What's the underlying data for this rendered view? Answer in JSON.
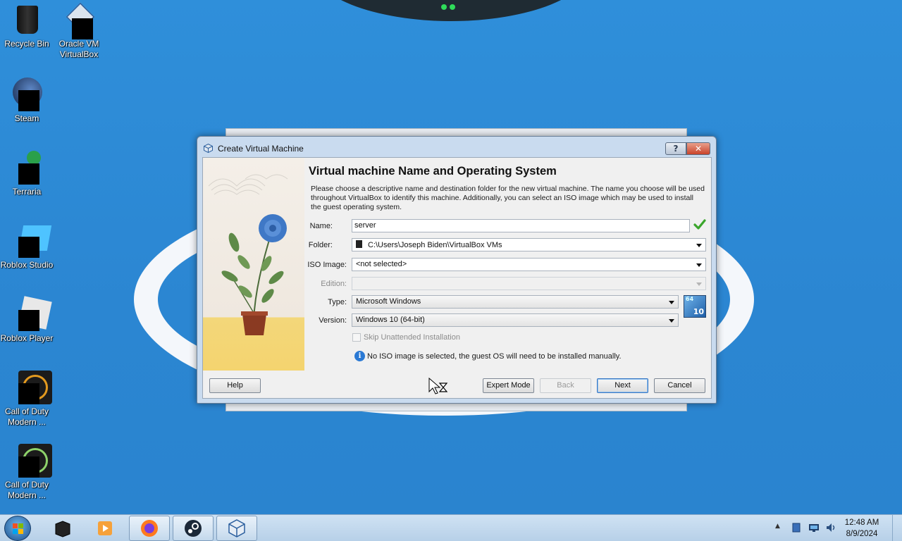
{
  "desktop": {
    "icons": [
      {
        "label": "Recycle Bin"
      },
      {
        "label": "Oracle VM VirtualBox"
      },
      {
        "label": "Steam"
      },
      {
        "label": "Terraria"
      },
      {
        "label": "Roblox Studio"
      },
      {
        "label": "Roblox Player"
      },
      {
        "label": "Call of Duty Modern ..."
      },
      {
        "label": "Call of Duty Modern ..."
      }
    ]
  },
  "dialog": {
    "title": "Create Virtual Machine",
    "help_glyph": "?",
    "close_glyph": "✕",
    "heading": "Virtual machine Name and Operating System",
    "description": "Please choose a descriptive name and destination folder for the new virtual machine. The name you choose will be used throughout VirtualBox to identify this machine. Additionally, you can select an ISO image which may be used to install the guest operating system.",
    "fields": {
      "name_label": "Name:",
      "name_value": "server",
      "folder_label": "Folder:",
      "folder_value": "C:\\Users\\Joseph Biden\\VirtualBox VMs",
      "iso_label": "ISO Image:",
      "iso_value": "<not selected>",
      "edition_label": "Edition:",
      "edition_value": "",
      "type_label": "Type:",
      "type_value": "Microsoft Windows",
      "version_label": "Version:",
      "version_value": "Windows 10 (64-bit)",
      "os_badge_bits": "64",
      "os_badge_num": "10",
      "skip_unattended_label": "Skip Unattended Installation",
      "skip_unattended_checked": false,
      "info_message": "No ISO image is selected, the guest OS will need to be installed manually."
    },
    "buttons": {
      "help": "Help",
      "expert_mode": "Expert Mode",
      "back": "Back",
      "next": "Next",
      "cancel": "Cancel"
    }
  },
  "taskbar": {
    "pinned": [
      "start-menu",
      "unknown-app",
      "media-player",
      "firefox",
      "steam",
      "virtualbox"
    ],
    "tray": {
      "expand_glyph": "▲"
    },
    "clock_time": "12:48 AM",
    "clock_date": "8/9/2024"
  },
  "colors": {
    "desktop_bg": "#2b8bd6",
    "dialog_accent": "#3b78c2",
    "ok_check": "#3aa52b"
  }
}
